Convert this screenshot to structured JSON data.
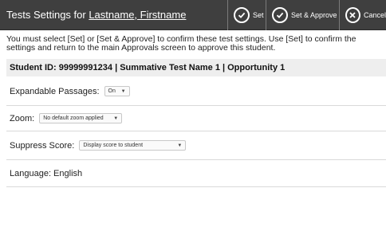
{
  "header": {
    "title_prefix": "Tests Settings for ",
    "student_name": "Lastname, Firstname",
    "buttons": {
      "set": "Set",
      "set_approve": "Set & Approve",
      "cancel": "Cancel"
    }
  },
  "instructions": "You must select [Set] or [Set & Approve] to confirm these test settings. Use [Set] to confirm the settings and return to the main Approvals screen to approve this student.",
  "student_bar": "Student ID: 99999991234 | Summative Test Name 1 | Opportunity 1",
  "settings": {
    "passages": {
      "label": "Expandable Passages:",
      "value": "On"
    },
    "zoom": {
      "label": "Zoom:",
      "value": "No default zoom applied"
    },
    "suppress": {
      "label": "Suppress Score:",
      "value": "Display score to student"
    },
    "language": {
      "label": "Language: English"
    }
  },
  "icons": {
    "set": "check-circle-icon",
    "set_approve": "check-circle-icon",
    "cancel": "close-circle-icon"
  }
}
